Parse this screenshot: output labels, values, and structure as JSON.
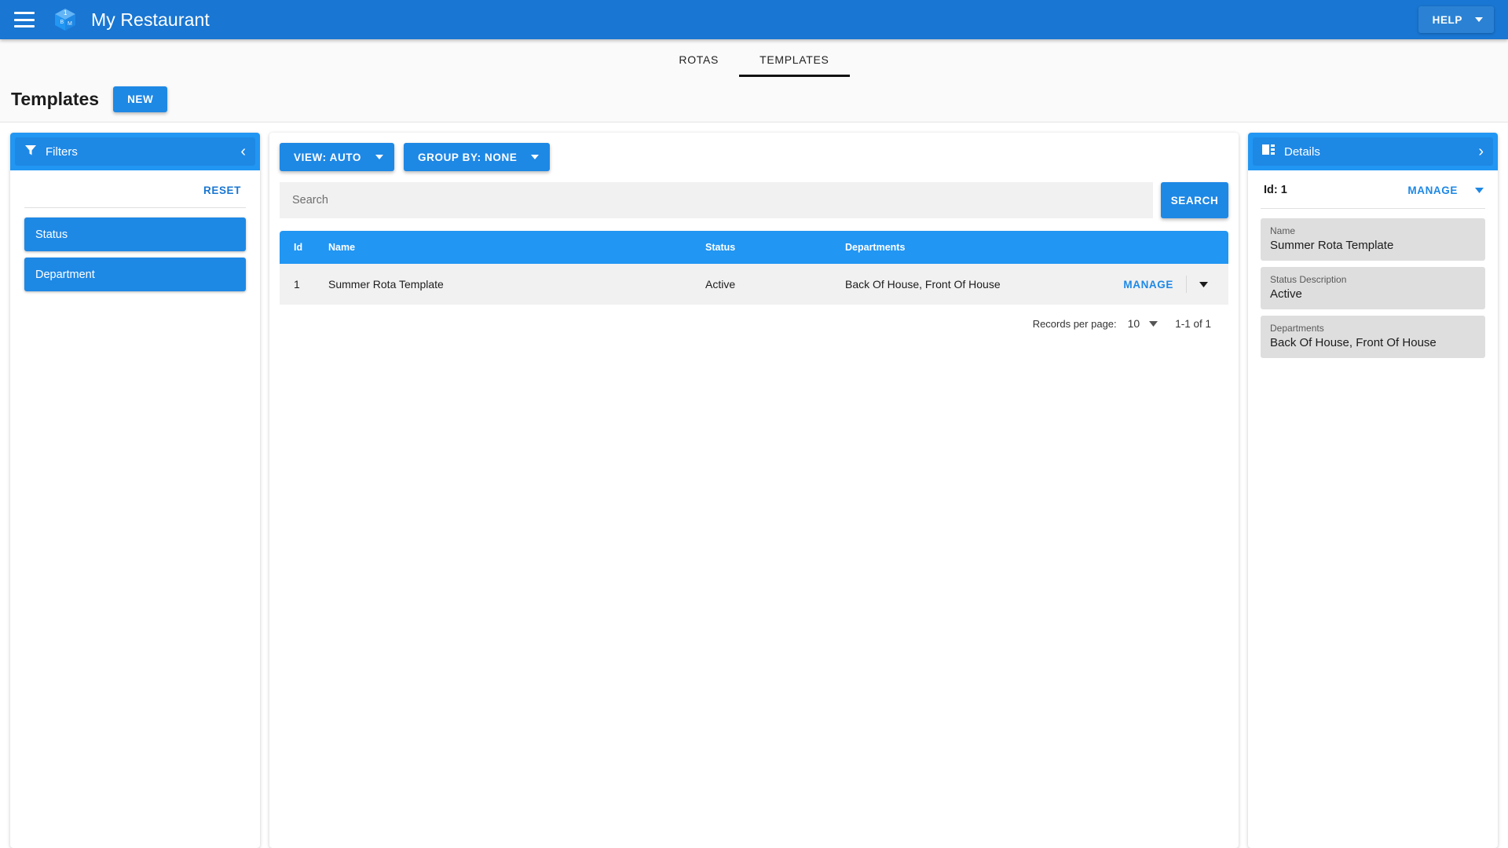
{
  "appbar": {
    "menu_icon": "hamburger-menu-icon",
    "logo_icon": "cube-logo-icon",
    "logo_badge": "1",
    "logo_left_letter": "B",
    "logo_right_letter": "M",
    "title": "My Restaurant",
    "help_label": "HELP",
    "background": "#1976d2",
    "help_background": "#2b82d4"
  },
  "tabs": [
    {
      "label": "ROTAS",
      "active": false
    },
    {
      "label": "TEMPLATES",
      "active": true
    }
  ],
  "page": {
    "title": "Templates",
    "new_label": "NEW"
  },
  "filters": {
    "icon": "funnel-icon",
    "title": "Filters",
    "collapse_icon": "chevron-left-icon",
    "reset_label": "RESET",
    "items": [
      {
        "label": "Status"
      },
      {
        "label": "Department"
      }
    ],
    "accent": "#2196f3",
    "item_background": "#1e88e5"
  },
  "toolbar": {
    "view_label": "VIEW: AUTO",
    "group_by_label": "GROUP BY: NONE"
  },
  "search": {
    "placeholder": "Search",
    "value": "",
    "button_label": "SEARCH"
  },
  "table": {
    "columns": [
      "Id",
      "Name",
      "Status",
      "Departments"
    ],
    "rows": [
      {
        "id": "1",
        "name": "Summer Rota Template",
        "status": "Active",
        "departments": "Back Of House, Front Of House",
        "manage_label": "MANAGE"
      }
    ],
    "header_background": "#2196f3",
    "row_background": "#f1f1f1"
  },
  "pagination": {
    "records_per_page_label": "Records per page:",
    "records_per_page_value": "10",
    "range_label": "1-1 of 1"
  },
  "details": {
    "icon": "view-quilt-icon",
    "title": "Details",
    "expand_icon": "chevron-right-icon",
    "id_label": "Id: 1",
    "manage_label": "MANAGE",
    "fields": [
      {
        "label": "Name",
        "value": "Summer Rota Template"
      },
      {
        "label": "Status Description",
        "value": "Active"
      },
      {
        "label": "Departments",
        "value": "Back Of House, Front Of House"
      }
    ]
  }
}
